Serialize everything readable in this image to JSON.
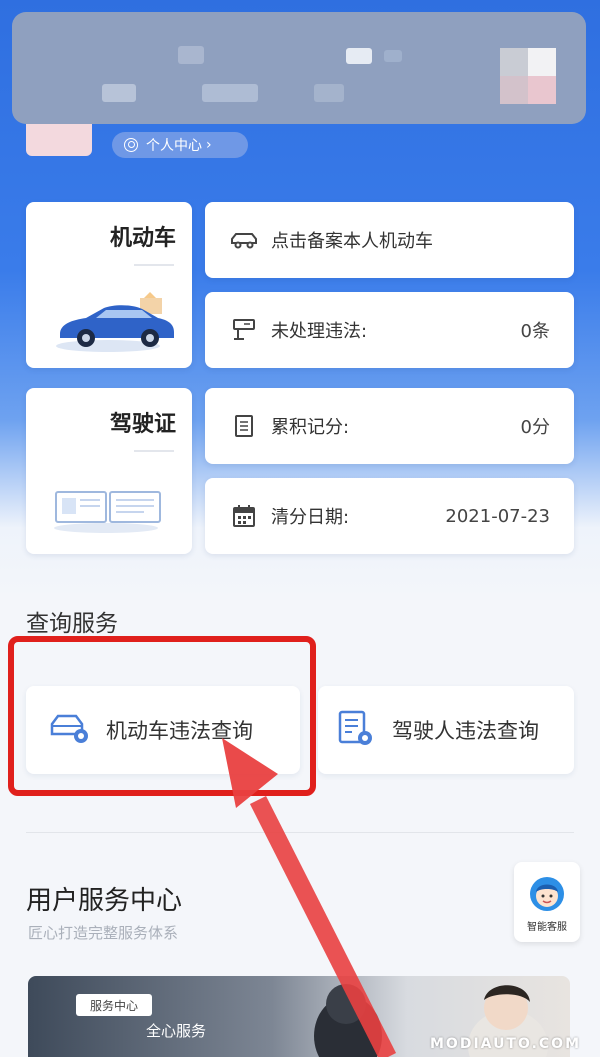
{
  "profile": {
    "center_link": "个人中心",
    "center_chevron": "›"
  },
  "vehicle": {
    "title": "机动车",
    "register_text": "点击备案本人机动车",
    "violations_label": "未处理违法:",
    "violations_value": "0条"
  },
  "license": {
    "title": "驾驶证",
    "points_label": "累积记分:",
    "points_value": "0分",
    "clear_date_label": "清分日期:",
    "clear_date_value": "2021-07-23"
  },
  "query_services": {
    "title": "查询服务",
    "vehicle_violation_query": "机动车违法查询",
    "driver_violation_query": "驾驶人违法查询"
  },
  "user_service_center": {
    "title": "用户服务中心",
    "subtitle": "匠心打造完整服务体系",
    "smart_cs_label": "智能客服",
    "banner_tag": "服务中心",
    "banner_text": "全心服务"
  },
  "watermark": "MODIAUTO.COM",
  "colors": {
    "primary_blue": "#3a7cea",
    "highlight_red": "#e0201c"
  }
}
